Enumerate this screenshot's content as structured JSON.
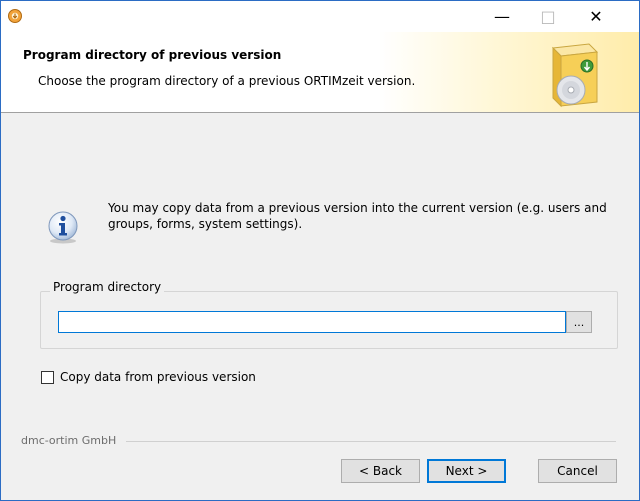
{
  "window": {
    "minimize_glyph": "—",
    "maximize_glyph": "□",
    "close_glyph": "✕"
  },
  "header": {
    "title": "Program directory of previous version",
    "subtitle": "Choose the program directory of a previous ORTIMzeit version."
  },
  "info": {
    "text": "You may copy data from a previous version into the current version (e.g. users and groups, forms, system settings)."
  },
  "program_directory": {
    "group_label": "Program directory",
    "value": "",
    "browse_label": "..."
  },
  "copy_option": {
    "label": "Copy data from previous version",
    "checked": false
  },
  "footer": {
    "brand": "dmc-ortim GmbH",
    "back_label": "< Back",
    "next_label": "Next >",
    "cancel_label": "Cancel"
  },
  "colors": {
    "accent": "#0078d7",
    "window_border": "#2b6cc4",
    "background": "#f0f0f0"
  }
}
